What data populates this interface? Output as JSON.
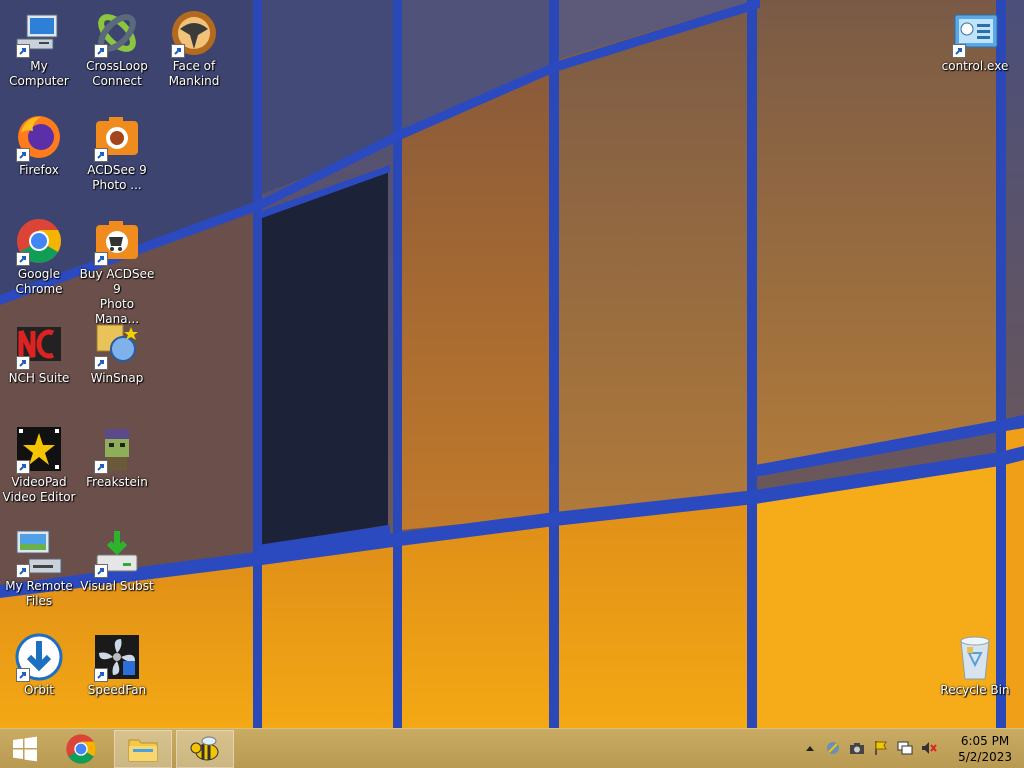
{
  "desktop": {
    "icons": [
      {
        "label": "My Computer",
        "icon": "my-computer-icon"
      },
      {
        "label": "CrossLoop\nConnect",
        "icon": "crossloop-icon"
      },
      {
        "label": "Face of\nMankind",
        "icon": "face-of-mankind-icon"
      },
      {
        "label": "control.exe",
        "icon": "control-panel-icon"
      },
      {
        "label": "Firefox",
        "icon": "firefox-icon"
      },
      {
        "label": "ACDSee 9\nPhoto ...",
        "icon": "acdsee-icon"
      },
      {
        "label": "Google\nChrome",
        "icon": "chrome-icon"
      },
      {
        "label": "Buy ACDSee 9\nPhoto Mana...",
        "icon": "acdsee-buy-icon"
      },
      {
        "label": "NCH Suite",
        "icon": "nch-icon"
      },
      {
        "label": "WinSnap",
        "icon": "winsnap-icon"
      },
      {
        "label": "VideoPad\nVideo Editor",
        "icon": "videopad-icon"
      },
      {
        "label": "Freakstein",
        "icon": "freakstein-icon"
      },
      {
        "label": "My Remote\nFiles",
        "icon": "remote-files-icon"
      },
      {
        "label": "Visual Subst",
        "icon": "visual-subst-icon"
      },
      {
        "label": "Orbit",
        "icon": "orbit-icon"
      },
      {
        "label": "SpeedFan",
        "icon": "speedfan-icon"
      },
      {
        "label": "Recycle Bin",
        "icon": "recycle-bin-icon"
      }
    ]
  },
  "taskbar": {
    "buttons": [
      {
        "name": "start",
        "icon": "windows-logo-icon"
      },
      {
        "name": "Google Chrome",
        "icon": "chrome-icon"
      },
      {
        "name": "File Explorer",
        "icon": "folder-icon"
      },
      {
        "name": "app",
        "icon": "bee-icon"
      }
    ],
    "tray_icons": [
      "chevron-up-icon",
      "tray-app-icon",
      "tray-camera-icon",
      "action-center-flag-icon",
      "network-icon",
      "volume-muted-icon"
    ],
    "clock": {
      "time": "6:05 PM",
      "date": "5/2/2023"
    }
  },
  "colors": {
    "taskbar": "#c2a45c",
    "frame": "#2a48b8",
    "glass_orange": "#f5a820"
  }
}
